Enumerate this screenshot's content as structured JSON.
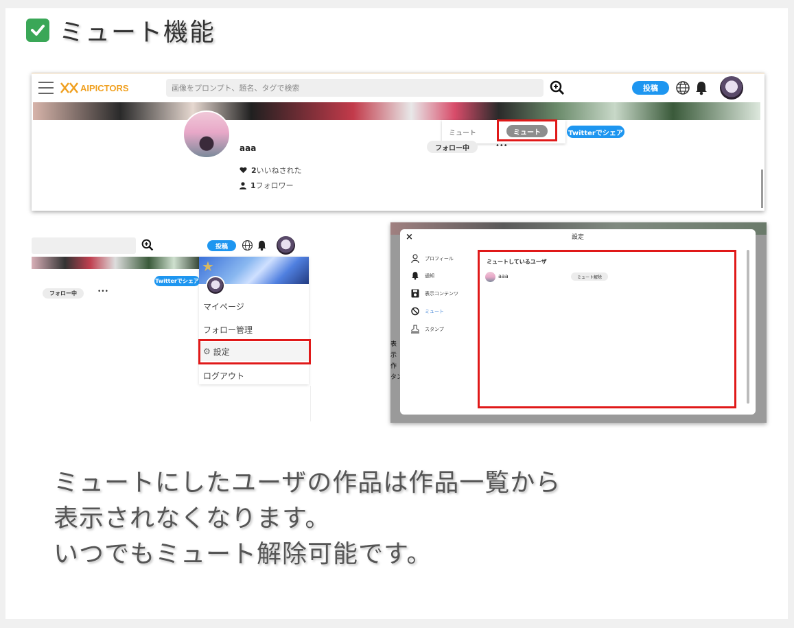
{
  "title": "ミュート機能",
  "header": {
    "logo_text": "AIPICTORS",
    "search_placeholder": "画像をプロンプト、題名、タグで検索",
    "post_button": "投稿"
  },
  "profile": {
    "username": "aaa",
    "follow_button": "フォロー中",
    "more": "•••",
    "likes_count": "2",
    "likes_label": "いいねされた",
    "followers_count": "1",
    "followers_label": "フォロワー",
    "twitter_share": "Twitterでシェア",
    "dropdown_label": "ミュート",
    "mute_button": "ミュート"
  },
  "user_menu": {
    "post_button": "投稿",
    "twitter_share": "Twitterでシェア",
    "follow_button": "フォロー中",
    "more": "•••",
    "items": [
      "マイページ",
      "フォロー管理",
      "設定",
      "ログアウト"
    ]
  },
  "settings": {
    "close": "×",
    "title": "設定",
    "nav": [
      "プロフィール",
      "通知",
      "表示コンテンツ",
      "ミュート",
      "スタンプ"
    ],
    "section_title": "ミュートしているユーザ",
    "muted_user": "aaa",
    "unmute_button": "ミュート解除",
    "background_fragments": [
      "表",
      "示",
      "作",
      "タン"
    ]
  },
  "caption": [
    "ミュートにしたユーザの作品は作品一覧から",
    "表示されなくなります。",
    "いつでもミュート解除可能です。"
  ],
  "colors": {
    "accent": "#1e96f0",
    "highlight": "#e01919",
    "logo": "#f0a020"
  }
}
